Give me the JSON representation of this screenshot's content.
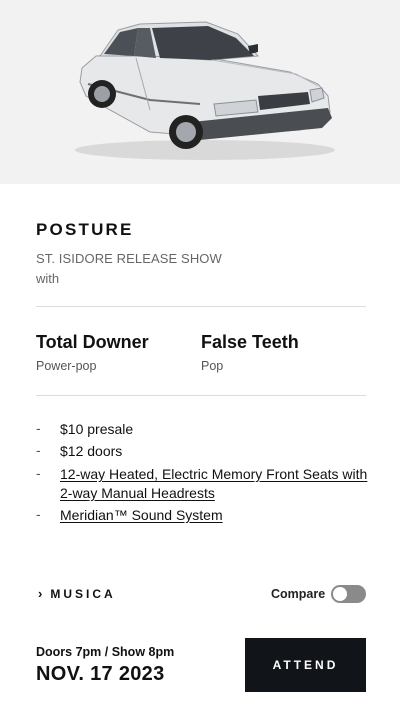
{
  "hero": {
    "image": "white-sedan-car"
  },
  "event": {
    "headliner": "POSTURE",
    "subtitle": "ST. ISIDORE RELEASE SHOW",
    "with_label": "with"
  },
  "artists": [
    {
      "name": "Total Downer",
      "genre": "Power-pop"
    },
    {
      "name": "False Teeth",
      "genre": "Pop"
    }
  ],
  "features": {
    "dash": "-",
    "items": [
      {
        "text": "$10 presale",
        "link": false
      },
      {
        "text": "$12 doors",
        "link": false
      },
      {
        "text": "12-way Heated, Electric Memory Front Seats with 2-way Manual Headrests",
        "link": true
      },
      {
        "text": "Meridian™ Sound System",
        "link": true
      }
    ]
  },
  "venue": {
    "chevron": "›",
    "label": "MUSICA"
  },
  "compare": {
    "label": "Compare",
    "enabled": false
  },
  "schedule": {
    "times": "Doors 7pm / Show 8pm",
    "date": "NOV. 17 2023"
  },
  "cta": {
    "label": "ATTEND"
  },
  "colors": {
    "button_bg": "#111419",
    "toggle_off": "#8a8a8a",
    "hero_bg": "#f2f2f2"
  }
}
